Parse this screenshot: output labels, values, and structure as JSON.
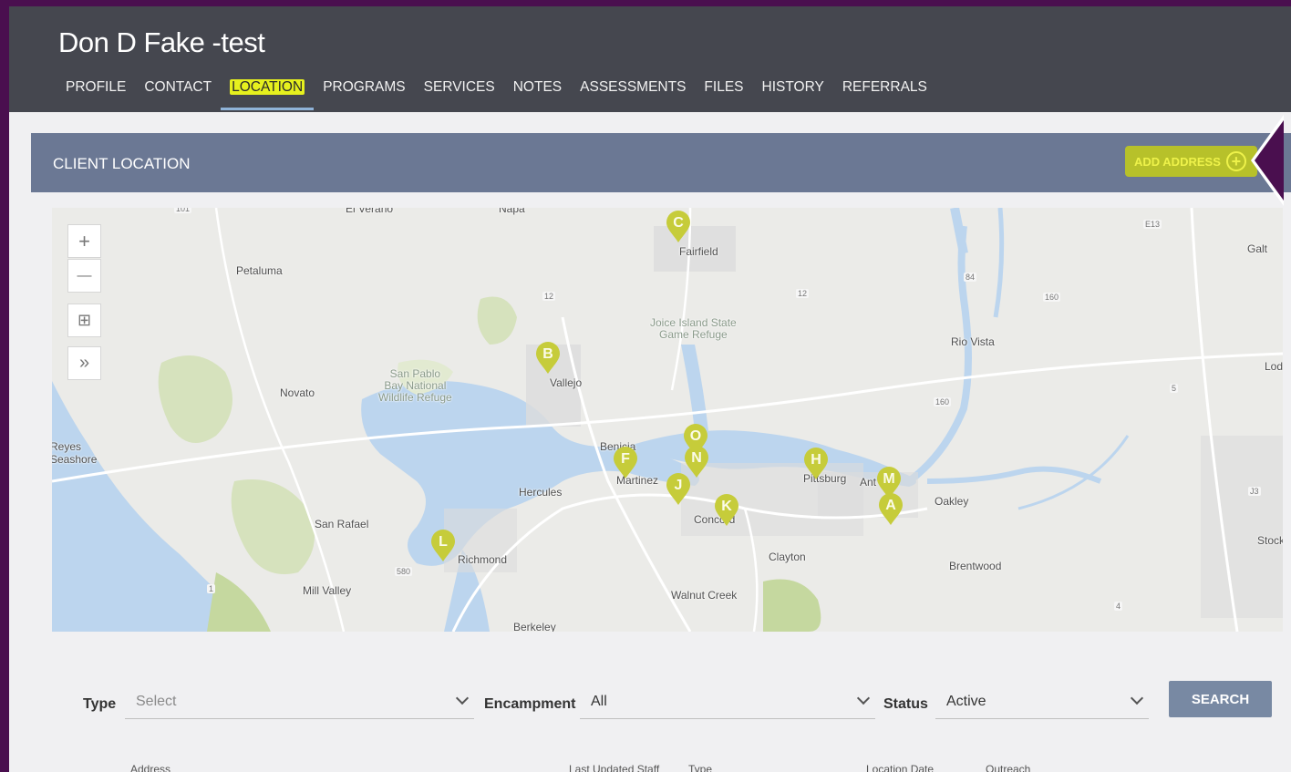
{
  "client": {
    "name": "Don D Fake -test"
  },
  "tabs": [
    {
      "label": "PROFILE"
    },
    {
      "label": "CONTACT"
    },
    {
      "label": "LOCATION"
    },
    {
      "label": "PROGRAMS"
    },
    {
      "label": "SERVICES"
    },
    {
      "label": "NOTES"
    },
    {
      "label": "ASSESSMENTS"
    },
    {
      "label": "FILES"
    },
    {
      "label": "HISTORY"
    },
    {
      "label": "REFERRALS"
    }
  ],
  "active_tab": "LOCATION",
  "panel": {
    "title": "CLIENT LOCATION",
    "add_label": "ADD ADDRESS"
  },
  "map": {
    "controls": {
      "zoom_in": "+",
      "zoom_out": "—",
      "grid": "⊞",
      "expand": "»"
    },
    "places": {
      "petaluma": "Petaluma",
      "fairfield": "Fairfield",
      "galt": "Galt",
      "napa": "Napa",
      "vallejo": "Vallejo",
      "novato": "Novato",
      "rio_vista": "Rio Vista",
      "lodi": "Lod",
      "reyes": "Reyes",
      "seashore": "Seashore",
      "benicia": "Benicia",
      "martinez": "Martinez",
      "hercules": "Hercules",
      "pittsburg": "Pittsburg",
      "antioch": "Ant",
      "oakley": "Oakley",
      "concord": "Concord",
      "san_rafael": "San Rafael",
      "richmond": "Richmond",
      "clayton": "Clayton",
      "brentwood": "Brentwood",
      "stockton": "Stockt",
      "mill_valley": "Mill Valley",
      "walnut_creek": "Walnut Creek",
      "berkeley": "Berkeley",
      "el_verano": "El Verano",
      "joice_1": "Joice Island State",
      "joice_2": "Game Refuge",
      "sanpablo_1": "San Pablo",
      "sanpablo_2": "Bay National",
      "sanpablo_3": "Wildlife Refuge"
    },
    "highways": {
      "h12a": "12",
      "h12b": "12",
      "h84": "84",
      "h160a": "160",
      "h160b": "160",
      "h5": "5",
      "e13": "E13",
      "h580": "580",
      "h4": "4",
      "j3": "J3",
      "h1": "1",
      "h101": "101"
    },
    "pins": [
      {
        "letter": "C"
      },
      {
        "letter": "B"
      },
      {
        "letter": "O"
      },
      {
        "letter": "N"
      },
      {
        "letter": "F"
      },
      {
        "letter": "H"
      },
      {
        "letter": "M"
      },
      {
        "letter": "J"
      },
      {
        "letter": "K"
      },
      {
        "letter": "A"
      },
      {
        "letter": "L"
      }
    ]
  },
  "filters": {
    "type": {
      "label": "Type",
      "value": "Select"
    },
    "encampment": {
      "label": "Encampment",
      "value": "All"
    },
    "status": {
      "label": "Status",
      "value": "Active"
    },
    "search_label": "SEARCH"
  },
  "table": {
    "columns": [
      "Address",
      "Last Updated Staff",
      "Type",
      "Location Date",
      "Outreach"
    ]
  },
  "colors": {
    "header_bg": "#45474f",
    "panel_bg": "#6b7894",
    "pin": "#c6cc3a",
    "highlight": "#e6f01e",
    "outer_bg": "#4a0f4f"
  }
}
